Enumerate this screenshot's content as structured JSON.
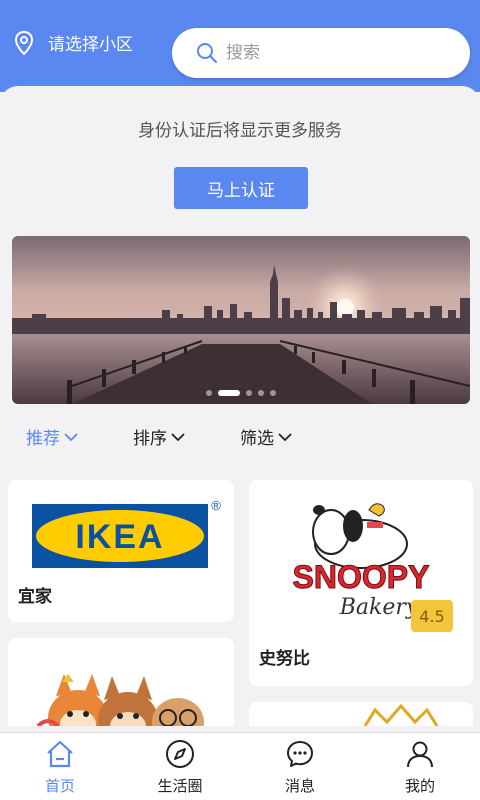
{
  "header": {
    "location_label": "请选择小区",
    "search_placeholder": "搜索"
  },
  "auth": {
    "tip": "身份认证后将显示更多服务",
    "button_label": "马上认证"
  },
  "banner": {
    "slide_count": 5,
    "active_index": 1
  },
  "filters": [
    {
      "label": "推荐",
      "active": true
    },
    {
      "label": "排序",
      "active": false
    },
    {
      "label": "筛选",
      "active": false
    }
  ],
  "shops": [
    {
      "name": "宜家",
      "logo_text": "IKEA",
      "logo_mark": "®"
    },
    {
      "name": "史努比",
      "logo_text": "SNOOPY",
      "logo_sub": "Bakery",
      "rating": "4.5"
    }
  ],
  "tabbar": [
    {
      "label": "首页",
      "icon": "home-icon",
      "active": true
    },
    {
      "label": "生活圈",
      "icon": "compass-icon",
      "active": false
    },
    {
      "label": "消息",
      "icon": "message-icon",
      "active": false
    },
    {
      "label": "我的",
      "icon": "user-icon",
      "active": false
    }
  ],
  "colors": {
    "primary": "#5b88f0",
    "ikea_blue": "#0a51a1",
    "ikea_yellow": "#ffcc00",
    "rating_bg": "#f4c53a"
  }
}
